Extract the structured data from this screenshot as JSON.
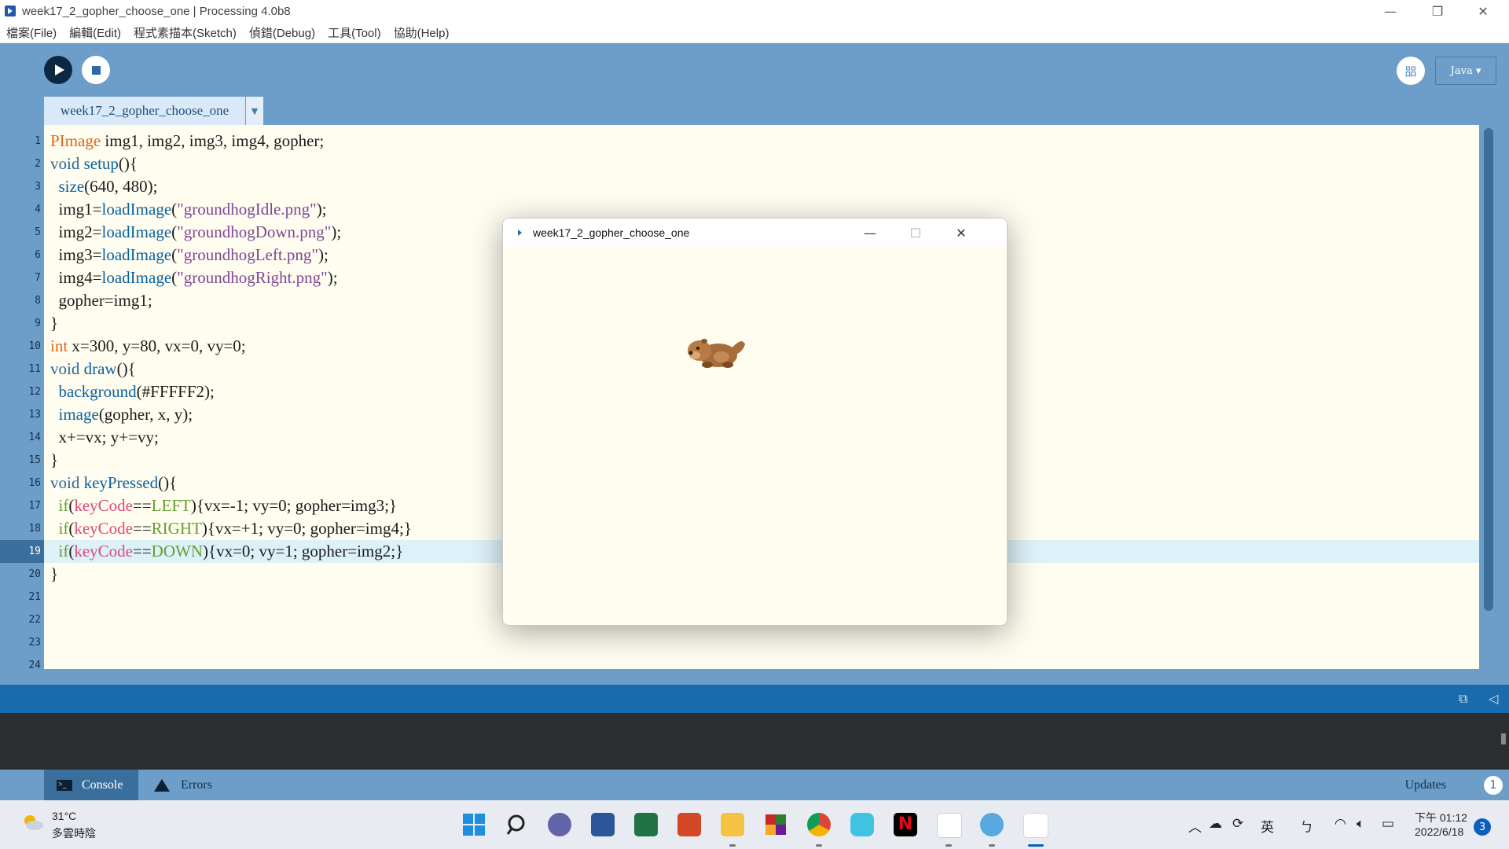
{
  "window": {
    "title": "week17_2_gopher_choose_one | Processing 4.0b8",
    "minimize": "—",
    "maximize": "❐",
    "close": "✕"
  },
  "menu": [
    "檔案(File)",
    "編輯(Edit)",
    "程式素描本(Sketch)",
    "偵錯(Debug)",
    "工具(Tool)",
    "協助(Help)"
  ],
  "toolbar": {
    "debug_icon": "㗊",
    "mode": "Java ▾"
  },
  "tab": {
    "name": "week17_2_gopher_choose_one",
    "menu_arrow": "▼"
  },
  "editor": {
    "current_line": 19,
    "line_numbers": [
      "1",
      "2",
      "3",
      "4",
      "5",
      "6",
      "7",
      "8",
      "9",
      "10",
      "11",
      "12",
      "13",
      "14",
      "15",
      "16",
      "17",
      "18",
      "19",
      "20",
      "21",
      "22",
      "23",
      "24"
    ],
    "code": [
      [
        {
          "t": "PImage",
          "c": "type"
        },
        {
          "t": " img1, img2, img3, img4, gopher;"
        }
      ],
      [
        {
          "t": "void",
          "c": "kw"
        },
        {
          "t": " "
        },
        {
          "t": "setup",
          "c": "fn"
        },
        {
          "t": "(){"
        }
      ],
      [
        {
          "t": "  "
        },
        {
          "t": "size",
          "c": "fn"
        },
        {
          "t": "(640, 480);"
        }
      ],
      [
        {
          "t": "  img1="
        },
        {
          "t": "loadImage",
          "c": "fn"
        },
        {
          "t": "("
        },
        {
          "t": "\"groundhogIdle.png\"",
          "c": "str"
        },
        {
          "t": ");"
        }
      ],
      [
        {
          "t": "  img2="
        },
        {
          "t": "loadImage",
          "c": "fn"
        },
        {
          "t": "("
        },
        {
          "t": "\"groundhogDown.png\"",
          "c": "str"
        },
        {
          "t": ");"
        }
      ],
      [
        {
          "t": "  img3="
        },
        {
          "t": "loadImage",
          "c": "fn"
        },
        {
          "t": "("
        },
        {
          "t": "\"groundhogLeft.png\"",
          "c": "str"
        },
        {
          "t": ");"
        }
      ],
      [
        {
          "t": "  img4="
        },
        {
          "t": "loadImage",
          "c": "fn"
        },
        {
          "t": "("
        },
        {
          "t": "\"groundhogRight.png\"",
          "c": "str"
        },
        {
          "t": ");"
        }
      ],
      [
        {
          "t": "  gopher=img1;"
        }
      ],
      [
        {
          "t": "}"
        }
      ],
      [
        {
          "t": "int",
          "c": "type"
        },
        {
          "t": " x=300, y=80, vx=0, vy=0;"
        }
      ],
      [
        {
          "t": "void",
          "c": "kw"
        },
        {
          "t": " "
        },
        {
          "t": "draw",
          "c": "fn"
        },
        {
          "t": "(){"
        }
      ],
      [
        {
          "t": "  "
        },
        {
          "t": "background",
          "c": "fn"
        },
        {
          "t": "(#FFFFF2);"
        }
      ],
      [
        {
          "t": "  "
        },
        {
          "t": "image",
          "c": "fn"
        },
        {
          "t": "(gopher, x, y);"
        }
      ],
      [
        {
          "t": "  x+=vx; y+=vy;"
        }
      ],
      [
        {
          "t": "}"
        }
      ],
      [
        {
          "t": "void",
          "c": "kw"
        },
        {
          "t": " "
        },
        {
          "t": "keyPressed",
          "c": "fn"
        },
        {
          "t": "(){"
        }
      ],
      [
        {
          "t": "  "
        },
        {
          "t": "if",
          "c": "cond"
        },
        {
          "t": "("
        },
        {
          "t": "keyCode",
          "c": "pink"
        },
        {
          "t": "=="
        },
        {
          "t": "LEFT",
          "c": "cond"
        },
        {
          "t": "){vx=-1; vy=0; gopher=img3;}"
        }
      ],
      [
        {
          "t": "  "
        },
        {
          "t": "if",
          "c": "cond"
        },
        {
          "t": "("
        },
        {
          "t": "keyCode",
          "c": "pink"
        },
        {
          "t": "=="
        },
        {
          "t": "RIGHT",
          "c": "cond"
        },
        {
          "t": "){vx=+1; vy=0; gopher=img4;}"
        }
      ],
      [
        {
          "t": "  "
        },
        {
          "t": "if",
          "c": "cond"
        },
        {
          "t": "("
        },
        {
          "t": "keyCode",
          "c": "pink"
        },
        {
          "t": "=="
        },
        {
          "t": "DOWN",
          "c": "cond"
        },
        {
          "t": "){vx=0; vy=1; gopher=img2;}"
        }
      ],
      [
        {
          "t": "}"
        }
      ],
      [],
      [],
      [],
      []
    ]
  },
  "footer": {
    "console_label": "Console",
    "errors_label": "Errors",
    "updates_label": "Updates",
    "updates_count": "1"
  },
  "sketch_window": {
    "title": "week17_2_gopher_choose_one",
    "minimize": "—",
    "maximize": "☐",
    "close": "✕",
    "gopher_icon": "gopher-sprite"
  },
  "taskbar": {
    "weather_temp": "31°C",
    "weather_desc": "多雲時陰",
    "ime": "英",
    "ime2": "ㄅ",
    "time": "下午 01:12",
    "date": "2022/6/18",
    "notifications": "3"
  },
  "colors": {
    "ide_blue": "#6c9ec9",
    "editor_bg": "#fffdf0",
    "status_bar": "#1a6bab"
  }
}
